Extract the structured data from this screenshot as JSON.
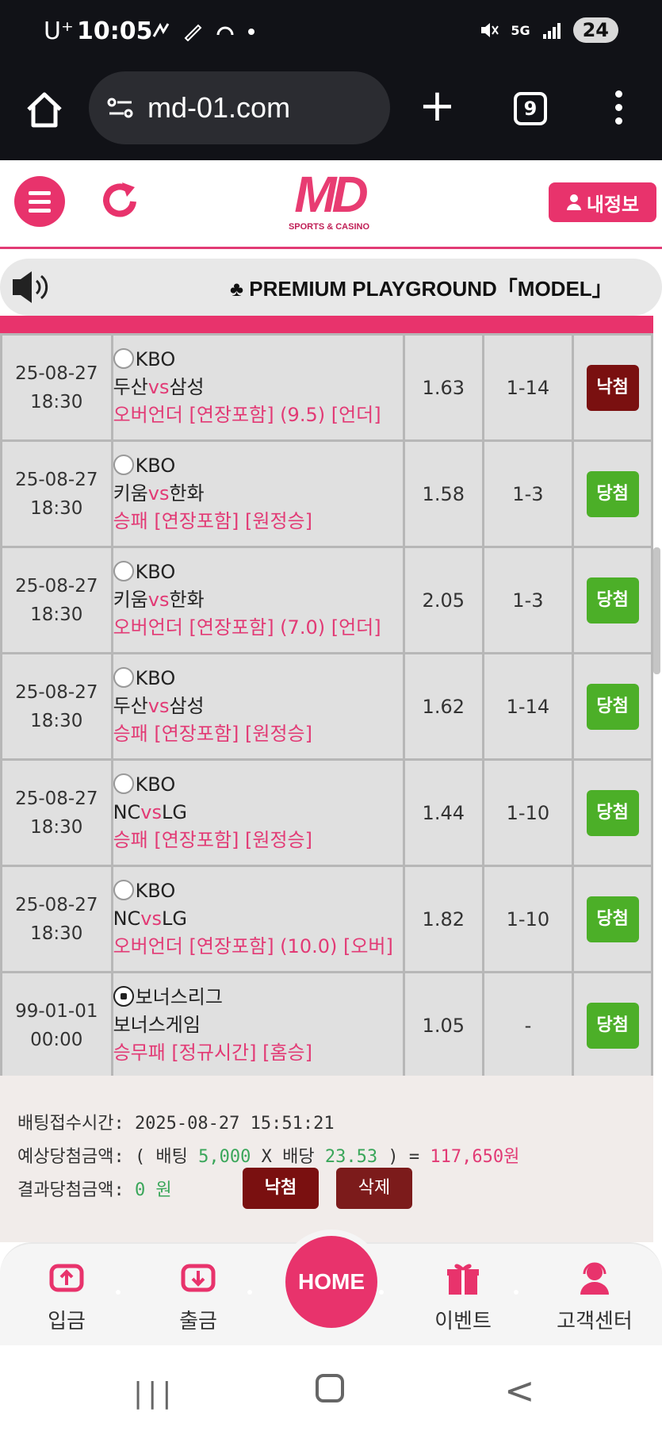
{
  "status_bar": {
    "carrier": "U⁺",
    "time": "10:05",
    "icons": [
      "gesture-icon",
      "pen-icon",
      "headset-icon",
      "dot-icon"
    ],
    "network": "5G",
    "battery": "24"
  },
  "browser": {
    "url": "md-01.com",
    "tab_count": "9"
  },
  "header": {
    "logo_text": "MD",
    "logo_sub": "SPORTS & CASINO",
    "myinfo_label": "내정보"
  },
  "marquee": {
    "text": "♣ PREMIUM PLAYGROUND「MODEL」"
  },
  "bets": [
    {
      "date": "25-08-27",
      "time": "18:30",
      "league": "KBO",
      "home": "두산",
      "vs": "vs",
      "away": "삼성",
      "market": "오버언더 [연장포함] (9.5) [언더]",
      "odds": "1.63",
      "score": "1-14",
      "result": "낙첨",
      "result_type": "lose"
    },
    {
      "date": "25-08-27",
      "time": "18:30",
      "league": "KBO",
      "home": "키움",
      "vs": "vs",
      "away": "한화",
      "market": "승패 [연장포함] [원정승]",
      "odds": "1.58",
      "score": "1-3",
      "result": "당첨",
      "result_type": "win"
    },
    {
      "date": "25-08-27",
      "time": "18:30",
      "league": "KBO",
      "home": "키움",
      "vs": "vs",
      "away": "한화",
      "market": "오버언더 [연장포함] (7.0) [언더]",
      "odds": "2.05",
      "score": "1-3",
      "result": "당첨",
      "result_type": "win"
    },
    {
      "date": "25-08-27",
      "time": "18:30",
      "league": "KBO",
      "home": "두산",
      "vs": "vs",
      "away": "삼성",
      "market": "승패 [연장포함] [원정승]",
      "odds": "1.62",
      "score": "1-14",
      "result": "당첨",
      "result_type": "win"
    },
    {
      "date": "25-08-27",
      "time": "18:30",
      "league": "KBO",
      "home": "NC",
      "vs": "vs",
      "away": "LG",
      "market": "승패 [연장포함] [원정승]",
      "odds": "1.44",
      "score": "1-10",
      "result": "당첨",
      "result_type": "win"
    },
    {
      "date": "25-08-27",
      "time": "18:30",
      "league": "KBO",
      "home": "NC",
      "vs": "vs",
      "away": "LG",
      "market": "오버언더 [연장포함] (10.0) [오버]",
      "odds": "1.82",
      "score": "1-10",
      "result": "당첨",
      "result_type": "win"
    },
    {
      "date": "99-01-01",
      "time": "00:00",
      "league": "보너스리그",
      "home": "보너스게임",
      "vs": "",
      "away": "",
      "market": "승무패 [정규시간] [홈승]",
      "odds": "1.05",
      "score": "-",
      "result": "당첨",
      "result_type": "win"
    }
  ],
  "summary": {
    "accept_label": "배팅접수시간:",
    "accept_time": "2025-08-27 15:51:21",
    "expected_label": "예상당첨금액:",
    "expected_open": "( 배팅",
    "bet_amount": "5,000",
    "times": "X 배당",
    "total_odds": "23.53",
    "expected_close": ") =",
    "expected_win": "117,650원",
    "result_label": "결과당첨금액:",
    "result_amount": "0 원",
    "lose_button": "낙첨",
    "delete_button": "삭제"
  },
  "bottom_nav": {
    "deposit": "입금",
    "withdraw": "출금",
    "home": "HOME",
    "event": "이벤트",
    "support": "고객센터"
  },
  "colors": {
    "brand_pink": "#e8336c",
    "lose_red": "#7a1010",
    "win_green": "#4caf28",
    "header_dark": "#111217"
  }
}
